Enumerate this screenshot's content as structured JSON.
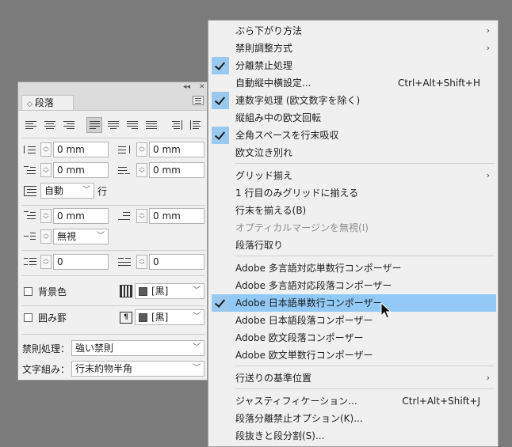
{
  "panel": {
    "title": "段落",
    "left_indent": "0 mm",
    "right_indent": "0 mm",
    "first_line_indent": "0 mm",
    "last_line_indent": "0 mm",
    "auto_leading": "自動",
    "grid_unit": "行",
    "space_before": "0 mm",
    "space_after": "0 mm",
    "drop_cap_style": "無視",
    "drop_cap_lines": "0",
    "drop_cap_chars": "0",
    "shading_label": "背景色",
    "shading_color": "[黒]",
    "border_label": "囲み罫",
    "border_color": "[黒]",
    "kinsoku_label": "禁則処理：",
    "kinsoku_value": "強い禁則",
    "mojikumi_label": "文字組み：",
    "mojikumi_value": "行末約物半角"
  },
  "menu": {
    "items": [
      {
        "label": "ぶら下がり方法",
        "submenu": true
      },
      {
        "label": "禁則調整方式",
        "submenu": true
      },
      {
        "label": "分離禁止処理",
        "checked": true
      },
      {
        "label": "自動縦中横設定...",
        "shortcut": "Ctrl+Alt+Shift+H"
      },
      {
        "label": "連数字処理 (欧文数字を除く)",
        "checked": true
      },
      {
        "label": "縦組み中の欧文回転"
      },
      {
        "label": "全角スペースを行末吸収",
        "checked": true
      },
      {
        "label": "欧文泣き別れ"
      },
      {
        "label": "グリッド揃え",
        "submenu": true
      },
      {
        "label": "1 行目のみグリッドに揃える"
      },
      {
        "label": "行末を揃える(B)"
      },
      {
        "label": "オプティカルマージンを無視(I)",
        "disabled": true
      },
      {
        "label": "段落行取り"
      },
      {
        "label": "Adobe 多言語対応単数行コンポーザー"
      },
      {
        "label": "Adobe 多言語対応段落コンポーザー"
      },
      {
        "label": "Adobe 日本語単数行コンポーザー",
        "checked": true,
        "highlighted": true
      },
      {
        "label": "Adobe 日本語段落コンポーザー"
      },
      {
        "label": "Adobe 欧文段落コンポーザー"
      },
      {
        "label": "Adobe 欧文単数行コンポーザー"
      },
      {
        "label": "行送りの基準位置",
        "submenu": true
      },
      {
        "label": "ジャスティフィケーション...",
        "shortcut": "Ctrl+Alt+Shift+J"
      },
      {
        "label": "段落分離禁止オプション(K)..."
      },
      {
        "label": "段抜きと段分割(S)..."
      }
    ],
    "submenu_arrow": "›",
    "accent_color": "#91c9f7"
  }
}
